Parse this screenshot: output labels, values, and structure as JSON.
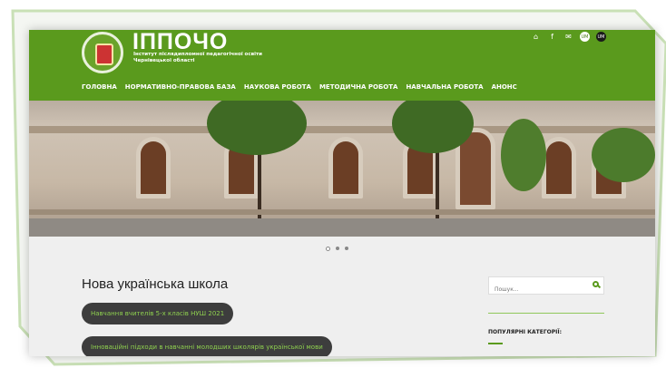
{
  "brand": {
    "title": "ІППОЧО",
    "subtitle": "Інститут післядипломної педагогічної освіти Чернівецької області"
  },
  "socials": [
    {
      "icon": "home-icon",
      "label": "⌂"
    },
    {
      "icon": "facebook-icon",
      "label": "f"
    },
    {
      "icon": "mail-icon",
      "label": "✉"
    },
    {
      "icon": "light-toggle-icon",
      "label": "UM"
    },
    {
      "icon": "dark-toggle-icon",
      "label": "UM"
    }
  ],
  "nav": [
    "ГОЛОВНА",
    "НОРМАТИВНО-ПРАВОВА БАЗА",
    "НАУКОВА РОБОТА",
    "МЕТОДИЧНА РОБОТА",
    "НАВЧАЛЬНА РОБОТА",
    "АНОНС"
  ],
  "carousel": {
    "slides": 3,
    "active": 1
  },
  "main": {
    "title": "Нова українська школа",
    "links": [
      "Навчання вчителів 5-х класів НУШ 2021",
      "Інноваційні підходи в навчанні молодших школярів української мови"
    ]
  },
  "sidebar": {
    "search_placeholder": "Пошук...",
    "categories_title": "ПОПУЛЯРНІ КАТЕГОРІЇ:"
  },
  "colors": {
    "brand": "#5a9a1d",
    "pill": "#3d3d3d",
    "pill_text": "#8fd14f"
  }
}
